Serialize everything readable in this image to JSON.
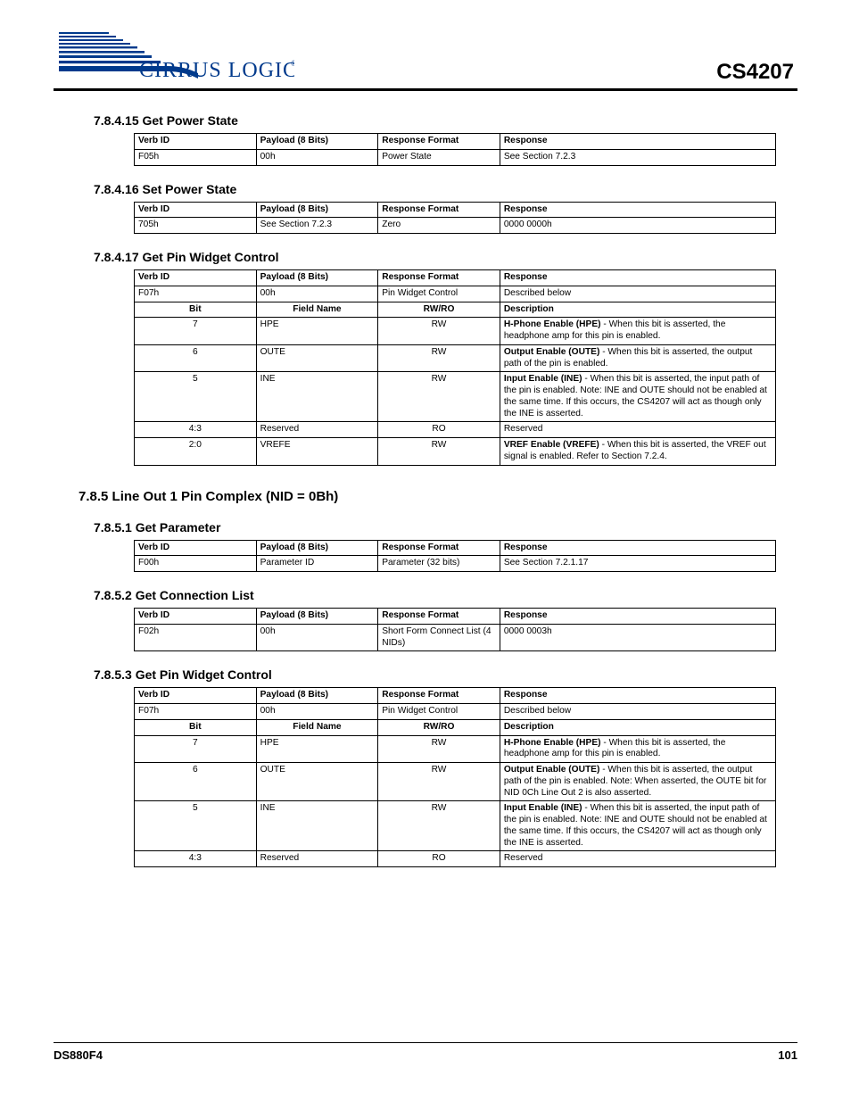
{
  "header": {
    "chip": "CS4207"
  },
  "footer": {
    "doc": "DS880F4",
    "page": "101"
  },
  "sec_a_get": {
    "heading": "7.8.4.15   Get Power State",
    "cols": [
      "Verb ID",
      "Payload (8 Bits)",
      "Response Format",
      "Response"
    ],
    "row": [
      "F05h",
      "00h",
      "Power State",
      "See Section 7.2.3"
    ]
  },
  "sec_a_set": {
    "heading": "7.8.4.16   Set Power State",
    "cols": [
      "Verb ID",
      "Payload (8 Bits)",
      "Response Format",
      "Response"
    ],
    "row": [
      "705h",
      "See Section 7.2.3",
      "Zero",
      "0000 0000h"
    ]
  },
  "sec_a_pw": {
    "heading": "7.8.4.17   Get Pin Widget Control",
    "cols": [
      "Verb ID",
      "Payload (8 Bits)",
      "Response Format",
      "Response"
    ],
    "row0": [
      "F07h",
      "00h",
      "Pin Widget Control",
      "Described below"
    ],
    "det_cols": [
      "Bit",
      "Field Name",
      "RW/RO",
      "Description"
    ],
    "rows": [
      [
        "7",
        "HPE",
        "RW",
        {
          "bold": "H-Phone Enable (HPE)",
          "rest": " - When this bit is asserted, the headphone amp for this pin is enabled."
        }
      ],
      [
        "6",
        "OUTE",
        "RW",
        {
          "bold": "Output Enable (OUTE)",
          "rest": " - When this bit is asserted, the output path of the pin is enabled."
        }
      ],
      [
        "5",
        "INE",
        "RW",
        {
          "bold": "Input Enable (INE)",
          "rest": " - When this bit is asserted, the input path of the pin is enabled. Note: INE and OUTE should not be enabled at the same time. If this occurs, the CS4207 will act as though only the INE is asserted."
        }
      ],
      [
        "4:3",
        "Reserved",
        "RO",
        "Reserved"
      ],
      [
        "2:0",
        "VREFE",
        "RW",
        {
          "bold": "VREF Enable (VREFE)",
          "rest": " - When this bit is asserted, the VREF out signal is enabled. Refer to Section 7.2.4."
        }
      ]
    ]
  },
  "node_b": {
    "heading": "7.8.5   Line Out 1 Pin Complex (NID = 0Bh)"
  },
  "sec_b_par": {
    "heading": "7.8.5.1    Get Parameter",
    "cols": [
      "Verb ID",
      "Payload (8 Bits)",
      "Response Format",
      "Response"
    ],
    "row": [
      "F00h",
      "Parameter ID",
      "Parameter (32 bits)",
      "See Section 7.2.1.17"
    ]
  },
  "sec_b_cl": {
    "heading": "7.8.5.2    Get Connection List",
    "cols": [
      "Verb ID",
      "Payload (8 Bits)",
      "Response Format",
      "Response"
    ],
    "row": [
      "F02h",
      "00h",
      "Short Form Connect List (4 NIDs)",
      "0000 0003h"
    ]
  },
  "sec_b_pw": {
    "heading": "7.8.5.3    Get Pin Widget Control",
    "cols": [
      "Verb ID",
      "Payload (8 Bits)",
      "Response Format",
      "Response"
    ],
    "row0": [
      "F07h",
      "00h",
      "Pin Widget Control",
      "Described below"
    ],
    "det_cols": [
      "Bit",
      "Field Name",
      "RW/RO",
      "Description"
    ],
    "rows": [
      [
        "7",
        "HPE",
        "RW",
        {
          "bold": "H-Phone Enable (HPE)",
          "rest": " - When this bit is asserted, the headphone amp for this pin is enabled."
        }
      ],
      [
        "6",
        "OUTE",
        "RW",
        {
          "bold": "Output Enable (OUTE)",
          "rest": " - When this bit is asserted, the output path of the pin is enabled. Note: When asserted, the OUTE bit for NID 0Ch Line Out 2 is also asserted."
        }
      ],
      [
        "5",
        "INE",
        "RW",
        {
          "bold": "Input Enable (INE)",
          "rest": " - When this bit is asserted, the input path of the pin is enabled. Note: INE and OUTE should not be enabled at the same time. If this occurs, the CS4207 will act as though only the INE is asserted."
        }
      ],
      [
        "4:3",
        "Reserved",
        "RO",
        "Reserved"
      ]
    ]
  }
}
